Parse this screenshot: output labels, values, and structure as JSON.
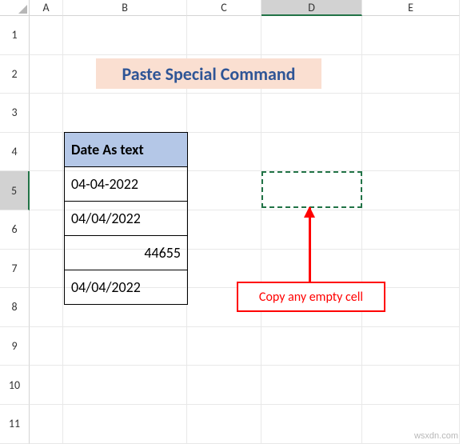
{
  "columns": [
    "A",
    "B",
    "C",
    "D",
    "E"
  ],
  "rows": [
    "1",
    "2",
    "3",
    "4",
    "5",
    "6",
    "7",
    "8",
    "9",
    "10",
    "11"
  ],
  "selected_row": "5",
  "selected_col": "D",
  "title": "Paste Special Command",
  "table": {
    "header": "Date As text",
    "cells": [
      {
        "value": "04-04-2022",
        "align": "left"
      },
      {
        "value": "04/04/2022",
        "align": "left"
      },
      {
        "value": "44655",
        "align": "right"
      },
      {
        "value": "04/04/2022",
        "align": "left"
      }
    ]
  },
  "annotation": "Copy any empty cell",
  "watermark": "wsxdn.com"
}
